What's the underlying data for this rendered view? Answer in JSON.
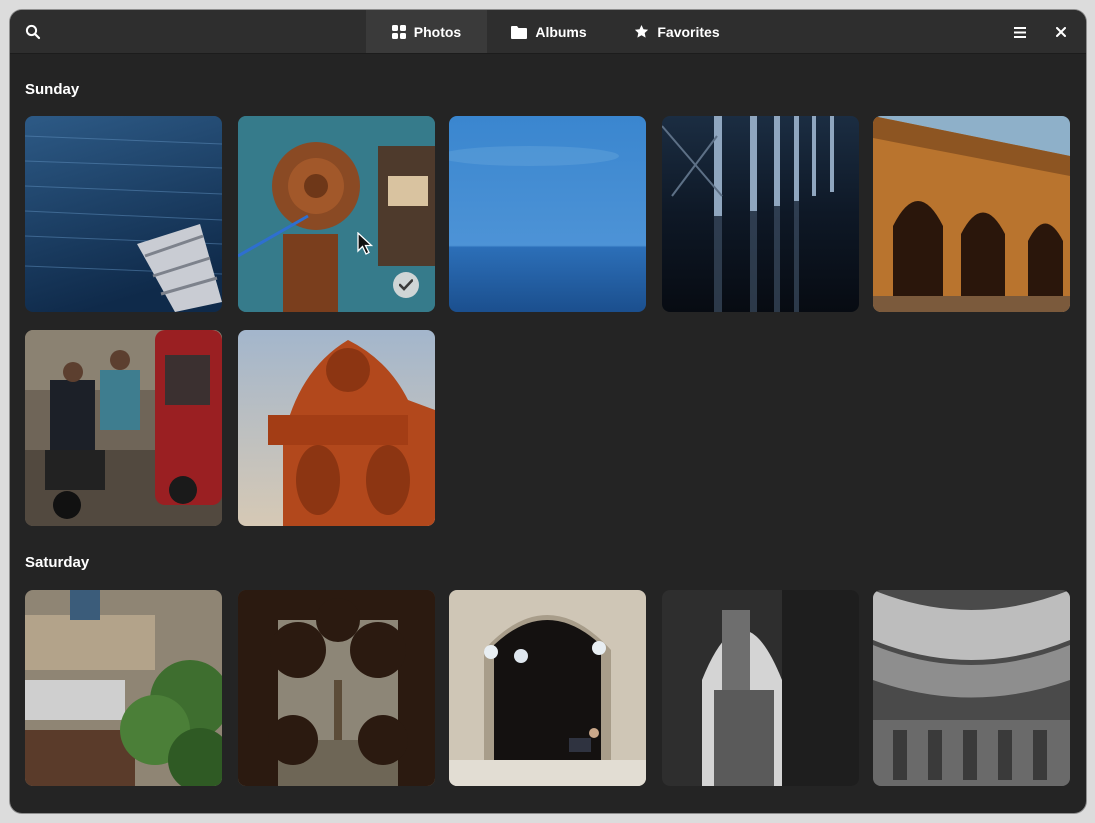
{
  "header": {
    "search_icon": "search-icon",
    "tabs": [
      {
        "label": "Photos",
        "icon": "grid-icon",
        "active": true
      },
      {
        "label": "Albums",
        "icon": "folder-icon",
        "active": false
      },
      {
        "label": "Favorites",
        "icon": "star-icon",
        "active": false
      }
    ],
    "menu_icon": "hamburger-menu-icon",
    "close_icon": "close-icon"
  },
  "sections": [
    {
      "title": "Sunday",
      "photos": [
        {
          "subject": "sea water with boat ladder"
        },
        {
          "subject": "rusty chain hook",
          "selected": true
        },
        {
          "subject": "blue sea horizon"
        },
        {
          "subject": "pier pillars over water"
        },
        {
          "subject": "stone arches"
        },
        {
          "subject": "street scene with motorbike and van"
        },
        {
          "subject": "carved wooden statue"
        }
      ]
    },
    {
      "title": "Saturday",
      "photos": [
        {
          "subject": "hotel sign with tree"
        },
        {
          "subject": "ornate window over city"
        },
        {
          "subject": "mosque doorway with lamps"
        },
        {
          "subject": "minaret through arch"
        },
        {
          "subject": "dome interior calligraphy"
        }
      ]
    }
  ],
  "colors": {
    "window_bg": "#242424",
    "header_bg": "#2e2e2e",
    "active_tab_bg": "#3a3a3a",
    "text": "#ffffff"
  }
}
